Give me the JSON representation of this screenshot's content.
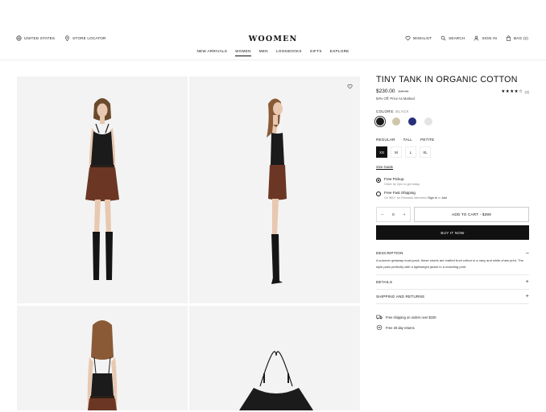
{
  "header": {
    "left_links": [
      {
        "label": "United States",
        "icon": "globe-icon"
      },
      {
        "label": "Store Locator",
        "icon": "location-pin-icon"
      }
    ],
    "logo": "WOOMEN",
    "right_links": [
      {
        "label": "Wishlist",
        "icon": "heart-icon"
      },
      {
        "label": "Search",
        "icon": "search-icon"
      },
      {
        "label": "Sign In",
        "icon": "user-icon"
      },
      {
        "label": "Bag (2)",
        "icon": "bag-icon"
      }
    ],
    "nav": [
      {
        "label": "New Arrivals",
        "active": false
      },
      {
        "label": "Women",
        "active": true
      },
      {
        "label": "Men",
        "active": false
      },
      {
        "label": "Lookbooks",
        "active": false
      },
      {
        "label": "Gifts",
        "active": false
      },
      {
        "label": "Explore",
        "active": false
      }
    ]
  },
  "gallery": {
    "images": [
      "model-front",
      "model-side",
      "model-back",
      "garment-flat"
    ],
    "wishlist_icon": "heart-icon"
  },
  "product": {
    "title": "TINY TANK IN ORGANIC COTTON",
    "price": "$230.00",
    "original_price": "$49.95",
    "rating_stars": "★★★★☆",
    "review_count": "(3)",
    "promo": "50% Off: Price As Marked",
    "colors_label": "Colors:",
    "selected_color": "Black",
    "colors": [
      {
        "name": "Black",
        "hex": "#1b1b1b",
        "selected": true
      },
      {
        "name": "Tan",
        "hex": "#cfc7a8",
        "selected": false
      },
      {
        "name": "Navy",
        "hex": "#26307a",
        "selected": false
      },
      {
        "name": "Light Grey",
        "hex": "#e4e4e4",
        "selected": false
      }
    ],
    "fits": [
      "Regular",
      "Tall",
      "Petite"
    ],
    "sizes": [
      {
        "label": "XS",
        "selected": true
      },
      {
        "label": "M",
        "selected": false
      },
      {
        "label": "L",
        "selected": false
      },
      {
        "label": "XL",
        "selected": false
      }
    ],
    "size_guide": "Size Guide",
    "shipping_options": [
      {
        "title": "Free Pickup",
        "sub": "Order by 2pm to get today",
        "checked": true
      },
      {
        "title": "Free Fast Shipping",
        "sub_pre": "On $50+ for Rewards Members ",
        "sign_in": "Sign in",
        "or": " or ",
        "join": "Join",
        "checked": false
      }
    ],
    "quantity": {
      "minus": "–",
      "value": "0",
      "plus": "+"
    },
    "add_to_cart": "ADD TO CART - $399",
    "buy_now": "BUY IT NOW",
    "accordions": [
      {
        "title": "Description",
        "sign": "–",
        "open": true,
        "body": "A summer getaway must-pack, these shorts are crafted from cotton in a navy and white chain print. The style pairs perfectly with a lightweight jacket in a matching print."
      },
      {
        "title": "Details",
        "sign": "+",
        "open": false
      },
      {
        "title": "Shipping and Returns",
        "sign": "+",
        "open": false
      }
    ],
    "perks": [
      {
        "icon": "truck-icon",
        "label": "Free shipping on orders over $100"
      },
      {
        "icon": "return-icon",
        "label": "Free 30 day returns"
      }
    ]
  }
}
